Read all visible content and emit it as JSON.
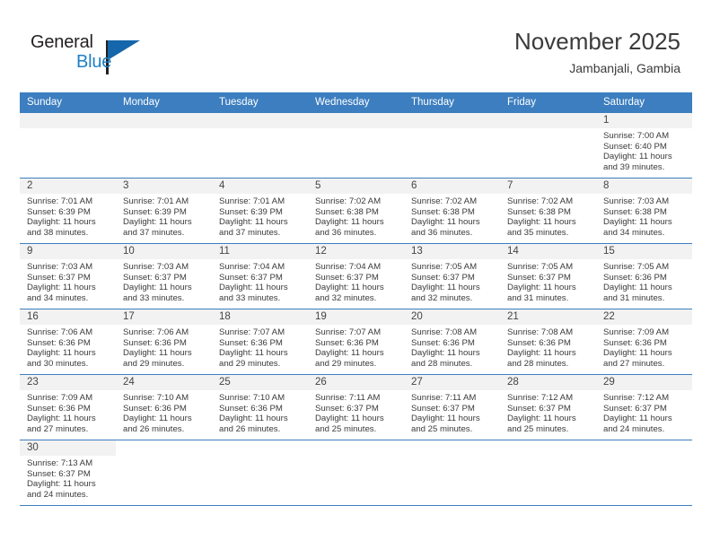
{
  "brand": {
    "name_part1": "General",
    "name_part2": "Blue",
    "accent_color": "#1566ab"
  },
  "header": {
    "title": "November 2025",
    "subtitle": "Jambanjali, Gambia"
  },
  "labels": {
    "sunrise_prefix": "Sunrise:",
    "sunset_prefix": "Sunset:",
    "daylight_prefix": "Daylight:"
  },
  "weekdays": [
    "Sunday",
    "Monday",
    "Tuesday",
    "Wednesday",
    "Thursday",
    "Friday",
    "Saturday"
  ],
  "theme": {
    "header_bg": "#3c7ebf",
    "daynum_bg": "#f2f2f2",
    "grid_line": "#3c7ebf"
  },
  "weeks": [
    [
      {
        "empty": true,
        "blank": false
      },
      {
        "empty": true,
        "blank": false
      },
      {
        "empty": true,
        "blank": false
      },
      {
        "empty": true,
        "blank": false
      },
      {
        "empty": true,
        "blank": false
      },
      {
        "empty": true,
        "blank": false
      },
      {
        "day": "1",
        "sunrise": "Sunrise: 7:00 AM",
        "sunset": "Sunset: 6:40 PM",
        "daylight1": "Daylight: 11 hours",
        "daylight2": "and 39 minutes."
      }
    ],
    [
      {
        "day": "2",
        "sunrise": "Sunrise: 7:01 AM",
        "sunset": "Sunset: 6:39 PM",
        "daylight1": "Daylight: 11 hours",
        "daylight2": "and 38 minutes."
      },
      {
        "day": "3",
        "sunrise": "Sunrise: 7:01 AM",
        "sunset": "Sunset: 6:39 PM",
        "daylight1": "Daylight: 11 hours",
        "daylight2": "and 37 minutes."
      },
      {
        "day": "4",
        "sunrise": "Sunrise: 7:01 AM",
        "sunset": "Sunset: 6:39 PM",
        "daylight1": "Daylight: 11 hours",
        "daylight2": "and 37 minutes."
      },
      {
        "day": "5",
        "sunrise": "Sunrise: 7:02 AM",
        "sunset": "Sunset: 6:38 PM",
        "daylight1": "Daylight: 11 hours",
        "daylight2": "and 36 minutes."
      },
      {
        "day": "6",
        "sunrise": "Sunrise: 7:02 AM",
        "sunset": "Sunset: 6:38 PM",
        "daylight1": "Daylight: 11 hours",
        "daylight2": "and 36 minutes."
      },
      {
        "day": "7",
        "sunrise": "Sunrise: 7:02 AM",
        "sunset": "Sunset: 6:38 PM",
        "daylight1": "Daylight: 11 hours",
        "daylight2": "and 35 minutes."
      },
      {
        "day": "8",
        "sunrise": "Sunrise: 7:03 AM",
        "sunset": "Sunset: 6:38 PM",
        "daylight1": "Daylight: 11 hours",
        "daylight2": "and 34 minutes."
      }
    ],
    [
      {
        "day": "9",
        "sunrise": "Sunrise: 7:03 AM",
        "sunset": "Sunset: 6:37 PM",
        "daylight1": "Daylight: 11 hours",
        "daylight2": "and 34 minutes."
      },
      {
        "day": "10",
        "sunrise": "Sunrise: 7:03 AM",
        "sunset": "Sunset: 6:37 PM",
        "daylight1": "Daylight: 11 hours",
        "daylight2": "and 33 minutes."
      },
      {
        "day": "11",
        "sunrise": "Sunrise: 7:04 AM",
        "sunset": "Sunset: 6:37 PM",
        "daylight1": "Daylight: 11 hours",
        "daylight2": "and 33 minutes."
      },
      {
        "day": "12",
        "sunrise": "Sunrise: 7:04 AM",
        "sunset": "Sunset: 6:37 PM",
        "daylight1": "Daylight: 11 hours",
        "daylight2": "and 32 minutes."
      },
      {
        "day": "13",
        "sunrise": "Sunrise: 7:05 AM",
        "sunset": "Sunset: 6:37 PM",
        "daylight1": "Daylight: 11 hours",
        "daylight2": "and 32 minutes."
      },
      {
        "day": "14",
        "sunrise": "Sunrise: 7:05 AM",
        "sunset": "Sunset: 6:37 PM",
        "daylight1": "Daylight: 11 hours",
        "daylight2": "and 31 minutes."
      },
      {
        "day": "15",
        "sunrise": "Sunrise: 7:05 AM",
        "sunset": "Sunset: 6:36 PM",
        "daylight1": "Daylight: 11 hours",
        "daylight2": "and 31 minutes."
      }
    ],
    [
      {
        "day": "16",
        "sunrise": "Sunrise: 7:06 AM",
        "sunset": "Sunset: 6:36 PM",
        "daylight1": "Daylight: 11 hours",
        "daylight2": "and 30 minutes."
      },
      {
        "day": "17",
        "sunrise": "Sunrise: 7:06 AM",
        "sunset": "Sunset: 6:36 PM",
        "daylight1": "Daylight: 11 hours",
        "daylight2": "and 29 minutes."
      },
      {
        "day": "18",
        "sunrise": "Sunrise: 7:07 AM",
        "sunset": "Sunset: 6:36 PM",
        "daylight1": "Daylight: 11 hours",
        "daylight2": "and 29 minutes."
      },
      {
        "day": "19",
        "sunrise": "Sunrise: 7:07 AM",
        "sunset": "Sunset: 6:36 PM",
        "daylight1": "Daylight: 11 hours",
        "daylight2": "and 29 minutes."
      },
      {
        "day": "20",
        "sunrise": "Sunrise: 7:08 AM",
        "sunset": "Sunset: 6:36 PM",
        "daylight1": "Daylight: 11 hours",
        "daylight2": "and 28 minutes."
      },
      {
        "day": "21",
        "sunrise": "Sunrise: 7:08 AM",
        "sunset": "Sunset: 6:36 PM",
        "daylight1": "Daylight: 11 hours",
        "daylight2": "and 28 minutes."
      },
      {
        "day": "22",
        "sunrise": "Sunrise: 7:09 AM",
        "sunset": "Sunset: 6:36 PM",
        "daylight1": "Daylight: 11 hours",
        "daylight2": "and 27 minutes."
      }
    ],
    [
      {
        "day": "23",
        "sunrise": "Sunrise: 7:09 AM",
        "sunset": "Sunset: 6:36 PM",
        "daylight1": "Daylight: 11 hours",
        "daylight2": "and 27 minutes."
      },
      {
        "day": "24",
        "sunrise": "Sunrise: 7:10 AM",
        "sunset": "Sunset: 6:36 PM",
        "daylight1": "Daylight: 11 hours",
        "daylight2": "and 26 minutes."
      },
      {
        "day": "25",
        "sunrise": "Sunrise: 7:10 AM",
        "sunset": "Sunset: 6:36 PM",
        "daylight1": "Daylight: 11 hours",
        "daylight2": "and 26 minutes."
      },
      {
        "day": "26",
        "sunrise": "Sunrise: 7:11 AM",
        "sunset": "Sunset: 6:37 PM",
        "daylight1": "Daylight: 11 hours",
        "daylight2": "and 25 minutes."
      },
      {
        "day": "27",
        "sunrise": "Sunrise: 7:11 AM",
        "sunset": "Sunset: 6:37 PM",
        "daylight1": "Daylight: 11 hours",
        "daylight2": "and 25 minutes."
      },
      {
        "day": "28",
        "sunrise": "Sunrise: 7:12 AM",
        "sunset": "Sunset: 6:37 PM",
        "daylight1": "Daylight: 11 hours",
        "daylight2": "and 25 minutes."
      },
      {
        "day": "29",
        "sunrise": "Sunrise: 7:12 AM",
        "sunset": "Sunset: 6:37 PM",
        "daylight1": "Daylight: 11 hours",
        "daylight2": "and 24 minutes."
      }
    ],
    [
      {
        "day": "30",
        "sunrise": "Sunrise: 7:13 AM",
        "sunset": "Sunset: 6:37 PM",
        "daylight1": "Daylight: 11 hours",
        "daylight2": "and 24 minutes."
      },
      {
        "empty": true,
        "blank": true
      },
      {
        "empty": true,
        "blank": true
      },
      {
        "empty": true,
        "blank": true
      },
      {
        "empty": true,
        "blank": true
      },
      {
        "empty": true,
        "blank": true
      },
      {
        "empty": true,
        "blank": true
      }
    ]
  ]
}
